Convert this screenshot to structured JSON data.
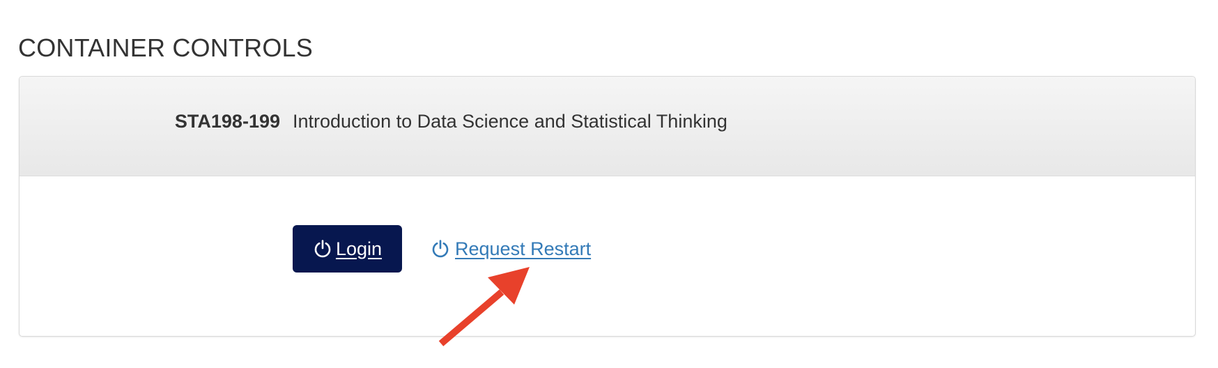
{
  "section": {
    "title": "CONTAINER CONTROLS"
  },
  "course": {
    "code": "STA198-199",
    "name": "Introduction to Data Science and Statistical Thinking"
  },
  "actions": {
    "login_label": "Login",
    "login_icon": "power-icon",
    "restart_label": "Request Restart",
    "restart_icon": "power-icon"
  },
  "colors": {
    "login_button_bg": "#07174f",
    "link": "#337ab7",
    "annotation_arrow": "#e8412b",
    "header_bg": "#efefef"
  }
}
